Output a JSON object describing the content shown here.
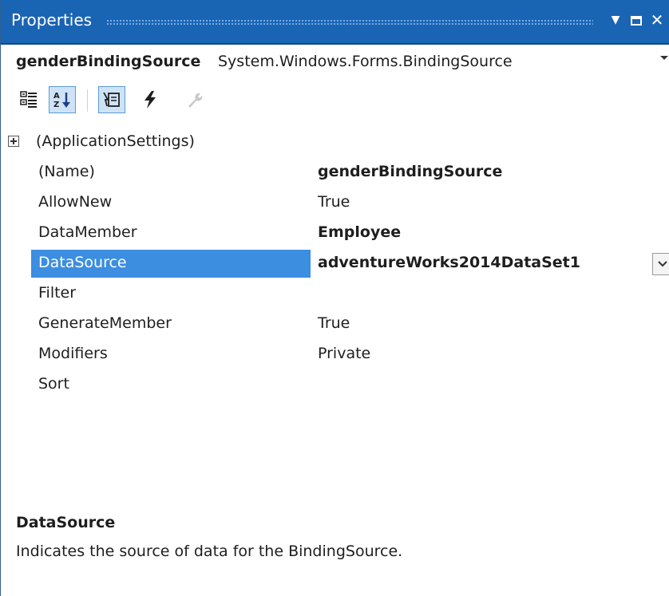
{
  "window": {
    "title": "Properties"
  },
  "object_selector": {
    "name": "genderBindingSource",
    "type": "System.Windows.Forms.BindingSource"
  },
  "toolbar": {
    "buttons": [
      {
        "name": "categorized-icon",
        "pressed": false
      },
      {
        "name": "alphabetical-icon",
        "pressed": true
      },
      {
        "name": "properties-icon",
        "pressed": true
      },
      {
        "name": "events-icon",
        "pressed": false
      },
      {
        "name": "property-pages-icon",
        "pressed": false,
        "disabled": true
      }
    ]
  },
  "properties": {
    "group": {
      "name": "(ApplicationSettings)"
    },
    "rows": [
      {
        "name": "(Name)",
        "value": "genderBindingSource",
        "bold": true
      },
      {
        "name": "AllowNew",
        "value": "True",
        "bold": false
      },
      {
        "name": "DataMember",
        "value": "Employee",
        "bold": true
      },
      {
        "name": "DataSource",
        "value": "adventureWorks2014DataSet1",
        "bold": true,
        "selected": true
      },
      {
        "name": "Filter",
        "value": "",
        "bold": false
      },
      {
        "name": "GenerateMember",
        "value": "True",
        "bold": false
      },
      {
        "name": "Modifiers",
        "value": "Private",
        "bold": false
      },
      {
        "name": "Sort",
        "value": "",
        "bold": false
      }
    ]
  },
  "description": {
    "title": "DataSource",
    "text": "Indicates the source of data for the BindingSource."
  },
  "colors": {
    "titlebar": "#1a64b4",
    "selection": "#3b8ee0"
  }
}
